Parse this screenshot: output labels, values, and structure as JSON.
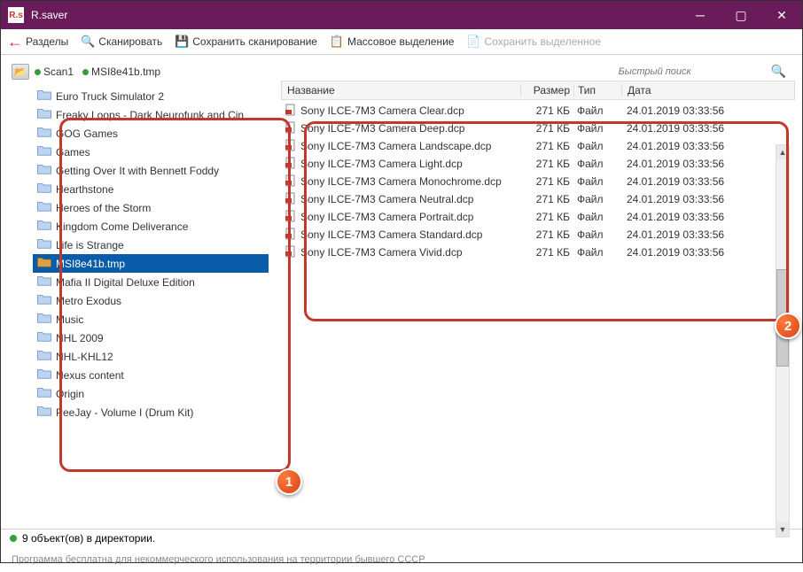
{
  "window": {
    "title": "R.saver",
    "icon_text": "R.s"
  },
  "toolbar": {
    "partitions": "Разделы",
    "scan": "Сканировать",
    "save_scan": "Сохранить сканирование",
    "mass_select": "Массовое выделение",
    "save_selected": "Сохранить выделенное"
  },
  "tabs": {
    "scan": "Scan1",
    "tmp": "MSI8e41b.tmp"
  },
  "search": {
    "placeholder": "Быстрый поиск"
  },
  "tree": {
    "items": [
      "Euro Truck Simulator 2",
      "Freaky Loops - Dark Neurofunk and Cin",
      "GOG Games",
      "Games",
      "Getting Over It with Bennett Foddy",
      "Hearthstone",
      "Heroes of the Storm",
      "Kingdom Come Deliverance",
      "Life is Strange",
      "MSI8e41b.tmp",
      "Mafia II Digital Deluxe Edition",
      "Metro Exodus",
      "Music",
      "NHL 2009",
      "NHL-KHL12",
      "Nexus content",
      "Origin",
      "PeeJay - Volume I (Drum Kit)"
    ],
    "selected_index": 9
  },
  "grid": {
    "headers": {
      "name": "Название",
      "size": "Размер",
      "type": "Тип",
      "date": "Дата"
    },
    "rows": [
      {
        "name": "Sony ILCE-7M3 Camera Clear.dcp",
        "size": "271 КБ",
        "type": "Файл",
        "date": "24.01.2019 03:33:56"
      },
      {
        "name": "Sony ILCE-7M3 Camera Deep.dcp",
        "size": "271 КБ",
        "type": "Файл",
        "date": "24.01.2019 03:33:56"
      },
      {
        "name": "Sony ILCE-7M3 Camera Landscape.dcp",
        "size": "271 КБ",
        "type": "Файл",
        "date": "24.01.2019 03:33:56"
      },
      {
        "name": "Sony ILCE-7M3 Camera Light.dcp",
        "size": "271 КБ",
        "type": "Файл",
        "date": "24.01.2019 03:33:56"
      },
      {
        "name": "Sony ILCE-7M3 Camera Monochrome.dcp",
        "size": "271 КБ",
        "type": "Файл",
        "date": "24.01.2019 03:33:56"
      },
      {
        "name": "Sony ILCE-7M3 Camera Neutral.dcp",
        "size": "271 КБ",
        "type": "Файл",
        "date": "24.01.2019 03:33:56"
      },
      {
        "name": "Sony ILCE-7M3 Camera Portrait.dcp",
        "size": "271 КБ",
        "type": "Файл",
        "date": "24.01.2019 03:33:56"
      },
      {
        "name": "Sony ILCE-7M3 Camera Standard.dcp",
        "size": "271 КБ",
        "type": "Файл",
        "date": "24.01.2019 03:33:56"
      },
      {
        "name": "Sony ILCE-7M3 Camera Vivid.dcp",
        "size": "271 КБ",
        "type": "Файл",
        "date": "24.01.2019 03:33:56"
      }
    ]
  },
  "status": "9 объект(ов) в директории.",
  "footer": "Программа бесплатна для некоммерческого использования на территории бывшего СССР",
  "badges": {
    "one": "1",
    "two": "2"
  }
}
